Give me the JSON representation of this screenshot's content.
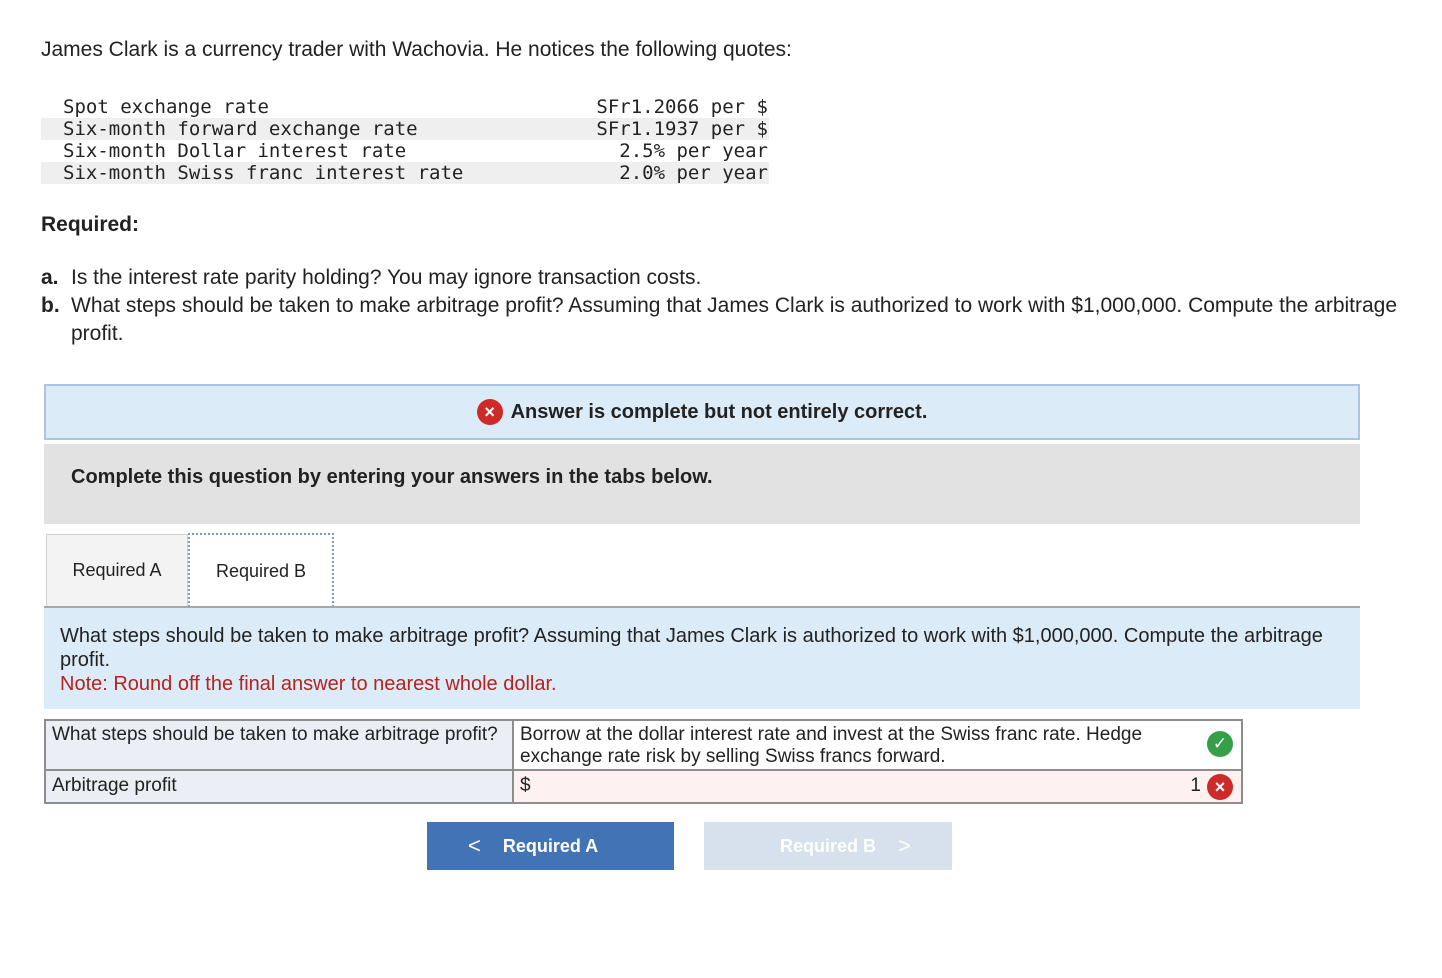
{
  "intro": "James Clark is a currency trader with Wachovia. He notices the following quotes:",
  "quotes": [
    {
      "label": "Spot exchange rate",
      "value": "SFr1.2066 per $"
    },
    {
      "label": "Six-month forward exchange rate",
      "value": "SFr1.1937 per $"
    },
    {
      "label": "Six-month Dollar interest rate",
      "value": "2.5% per year"
    },
    {
      "label": "Six-month Swiss franc interest rate",
      "value": "2.0% per year"
    }
  ],
  "required_heading": "Required:",
  "questions": [
    {
      "letter": "a.",
      "text": "Is the interest rate parity holding? You may ignore transaction costs."
    },
    {
      "letter": "b.",
      "text": "What steps should be taken to make arbitrage profit? Assuming that James Clark is authorized to work with $1,000,000. Compute the arbitrage profit."
    }
  ],
  "banner": {
    "icon": "×",
    "text": "Answer is complete but not entirely correct."
  },
  "instructions": "Complete this question by entering your answers in the tabs below.",
  "tabs": [
    {
      "label": "Required A"
    },
    {
      "label": "Required B"
    }
  ],
  "panel": {
    "text": "What steps should be taken to make arbitrage profit? Assuming that James Clark is authorized to work with $1,000,000. Compute the arbitrage profit.",
    "note": "Note: Round off the final answer to nearest whole dollar."
  },
  "answers": {
    "row1": {
      "label": "What steps should be taken to make arbitrage profit?",
      "value": "Borrow at the dollar interest rate and invest at the Swiss franc rate. Hedge exchange rate risk by selling Swiss francs forward.",
      "icon": "✓"
    },
    "row2": {
      "label": "Arbitrage profit",
      "prefix": "$",
      "value": "",
      "points": "1",
      "icon": "×"
    }
  },
  "nav": {
    "prev_label": "Required A",
    "prev_chevron": "<",
    "next_label": "Required B",
    "next_chevron": ">"
  },
  "colors": {
    "accent": "#4274b5",
    "error": "#cf2a2a",
    "success": "#35a048",
    "note": "#b4231f"
  }
}
